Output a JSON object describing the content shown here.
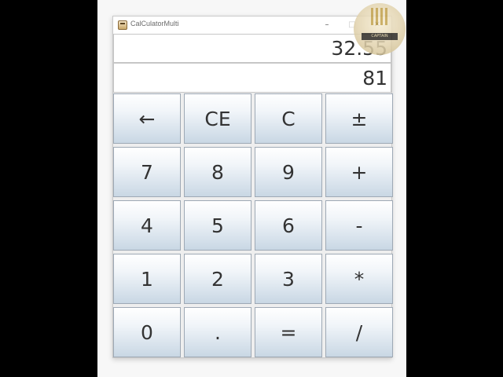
{
  "window": {
    "title": "CalCulatorMulti",
    "controls": {
      "minimize": "–",
      "maximize": "□",
      "close": "✕"
    }
  },
  "display": {
    "main_value": "32.55",
    "secondary_value": "81"
  },
  "keys": [
    {
      "label": "←",
      "name": "backspace-button"
    },
    {
      "label": "CE",
      "name": "clear-entry-button"
    },
    {
      "label": "C",
      "name": "clear-button"
    },
    {
      "label": "±",
      "name": "negate-button"
    },
    {
      "label": "7",
      "name": "digit-7-button"
    },
    {
      "label": "8",
      "name": "digit-8-button"
    },
    {
      "label": "9",
      "name": "digit-9-button"
    },
    {
      "label": "+",
      "name": "add-button"
    },
    {
      "label": "4",
      "name": "digit-4-button"
    },
    {
      "label": "5",
      "name": "digit-5-button"
    },
    {
      "label": "6",
      "name": "digit-6-button"
    },
    {
      "label": "-",
      "name": "subtract-button"
    },
    {
      "label": "1",
      "name": "digit-1-button"
    },
    {
      "label": "2",
      "name": "digit-2-button"
    },
    {
      "label": "3",
      "name": "digit-3-button"
    },
    {
      "label": "*",
      "name": "multiply-button"
    },
    {
      "label": "0",
      "name": "digit-0-button"
    },
    {
      "label": ".",
      "name": "decimal-button"
    },
    {
      "label": "=",
      "name": "equals-button"
    },
    {
      "label": "/",
      "name": "divide-button"
    }
  ],
  "watermark": {
    "text": "CAPTAIN",
    "icon": "seal-logo-icon"
  },
  "colors": {
    "key_border": "#9ea9b5",
    "key_gradient_bottom": "#c9d7e4",
    "text": "#333333"
  }
}
